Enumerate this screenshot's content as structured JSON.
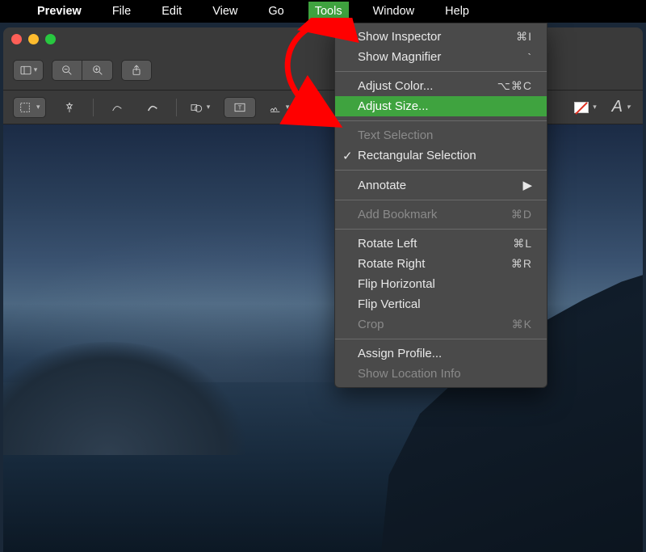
{
  "menubar": {
    "app": "Preview",
    "items": [
      "File",
      "Edit",
      "View",
      "Go",
      "Tools",
      "Window",
      "Help"
    ],
    "open": "Tools"
  },
  "dropdown": {
    "sections": [
      [
        {
          "label": "Show Inspector",
          "shortcut": "⌘I",
          "enabled": true
        },
        {
          "label": "Show Magnifier",
          "shortcut": "`",
          "enabled": true
        }
      ],
      [
        {
          "label": "Adjust Color...",
          "shortcut": "⌥⌘C",
          "enabled": true
        },
        {
          "label": "Adjust Size...",
          "shortcut": "",
          "enabled": true,
          "highlight": true
        }
      ],
      [
        {
          "label": "Text Selection",
          "shortcut": "",
          "enabled": false
        },
        {
          "label": "Rectangular Selection",
          "shortcut": "",
          "enabled": true,
          "checked": true
        }
      ],
      [
        {
          "label": "Annotate",
          "shortcut": "",
          "enabled": true,
          "submenu": true
        }
      ],
      [
        {
          "label": "Add Bookmark",
          "shortcut": "⌘D",
          "enabled": false
        }
      ],
      [
        {
          "label": "Rotate Left",
          "shortcut": "⌘L",
          "enabled": true
        },
        {
          "label": "Rotate Right",
          "shortcut": "⌘R",
          "enabled": true
        },
        {
          "label": "Flip Horizontal",
          "shortcut": "",
          "enabled": true
        },
        {
          "label": "Flip Vertical",
          "shortcut": "",
          "enabled": true
        },
        {
          "label": "Crop",
          "shortcut": "⌘K",
          "enabled": false
        }
      ],
      [
        {
          "label": "Assign Profile...",
          "shortcut": "",
          "enabled": true
        },
        {
          "label": "Show Location Info",
          "shortcut": "",
          "enabled": false
        }
      ]
    ]
  },
  "editbar": {
    "font_label": "A"
  },
  "colors": {
    "menu_highlight": "#3fa33f",
    "annotation_red": "#ff0000"
  }
}
